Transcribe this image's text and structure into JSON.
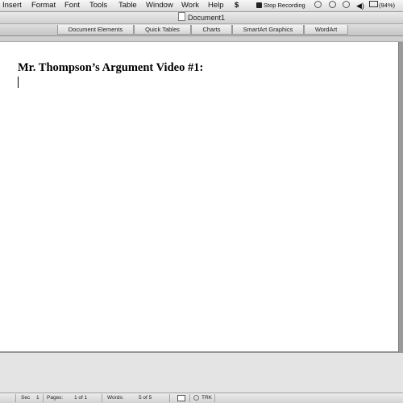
{
  "menubar": {
    "items": [
      "Insert",
      "Format",
      "Font",
      "Tools",
      "Table",
      "Window",
      "Work",
      "Help"
    ],
    "script_icon": "$",
    "stop_recording": "Stop Recording",
    "battery": "(94%)"
  },
  "window": {
    "title": "Document1"
  },
  "ribbon": {
    "tabs": [
      "Document Elements",
      "Quick Tables",
      "Charts",
      "SmartArt Graphics",
      "WordArt"
    ]
  },
  "document": {
    "title": "Mr. Thompson’s Argument Video #1:"
  },
  "statusbar": {
    "sec_label": "Sec",
    "sec_value": "1",
    "pages_label": "Pages:",
    "pages_value": "1 of 1",
    "words_label": "Words:",
    "words_value": "5 of 5",
    "trk": "TRK"
  },
  "colors": {
    "page": "#ffffff",
    "workspace": "#9a9a9a",
    "chrome": "#dcdcdc"
  }
}
